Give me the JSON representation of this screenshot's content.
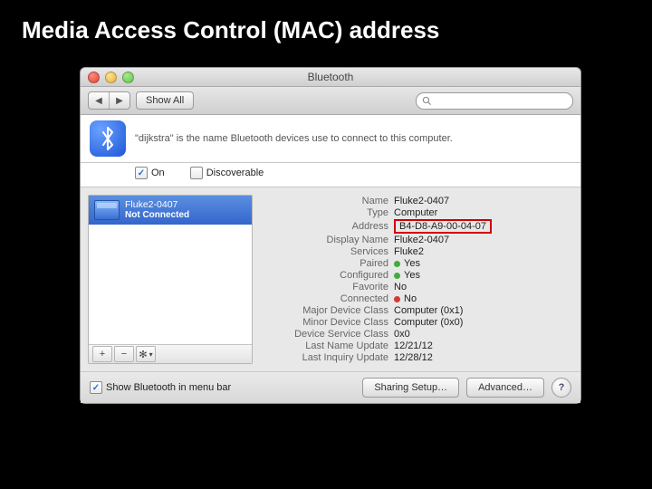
{
  "slide": {
    "title": "Media Access Control (MAC) address"
  },
  "window": {
    "title": "Bluetooth",
    "toolbar": {
      "back_icon": "◀",
      "forward_icon": "▶",
      "show_all": "Show All",
      "search_placeholder": ""
    },
    "info_text": "\"dijkstra\" is the name Bluetooth devices use to connect to this computer.",
    "checks": {
      "on_label": "On",
      "on_checked": "✓",
      "discoverable_label": "Discoverable",
      "discoverable_checked": ""
    },
    "sidebar": {
      "device_name": "Fluke2-0407",
      "device_status": "Not Connected",
      "foot": {
        "plus": "+",
        "minus": "−",
        "gear": "✻",
        "menu": "▾"
      }
    },
    "detail": {
      "rows": [
        {
          "k": "Name",
          "v": "Fluke2-0407"
        },
        {
          "k": "Type",
          "v": "Computer"
        },
        {
          "k": "Address",
          "v": "B4-D8-A9-00-04-07"
        },
        {
          "k": "Display Name",
          "v": "Fluke2-0407"
        },
        {
          "k": "Services",
          "v": "Fluke2"
        },
        {
          "k": "Paired",
          "v": "Yes"
        },
        {
          "k": "Configured",
          "v": "Yes"
        },
        {
          "k": "Favorite",
          "v": "No"
        },
        {
          "k": "Connected",
          "v": "No"
        },
        {
          "k": "Major Device Class",
          "v": "Computer (0x1)"
        },
        {
          "k": "Minor Device Class",
          "v": "Computer (0x0)"
        },
        {
          "k": "Device Service Class",
          "v": "0x0"
        },
        {
          "k": "Last Name Update",
          "v": "12/21/12"
        },
        {
          "k": "Last Inquiry Update",
          "v": "12/28/12"
        }
      ]
    },
    "footer": {
      "menubar_label": "Show Bluetooth in menu bar",
      "menubar_checked": "✓",
      "sharing_btn": "Sharing Setup…",
      "advanced_btn": "Advanced…",
      "help": "?"
    }
  }
}
